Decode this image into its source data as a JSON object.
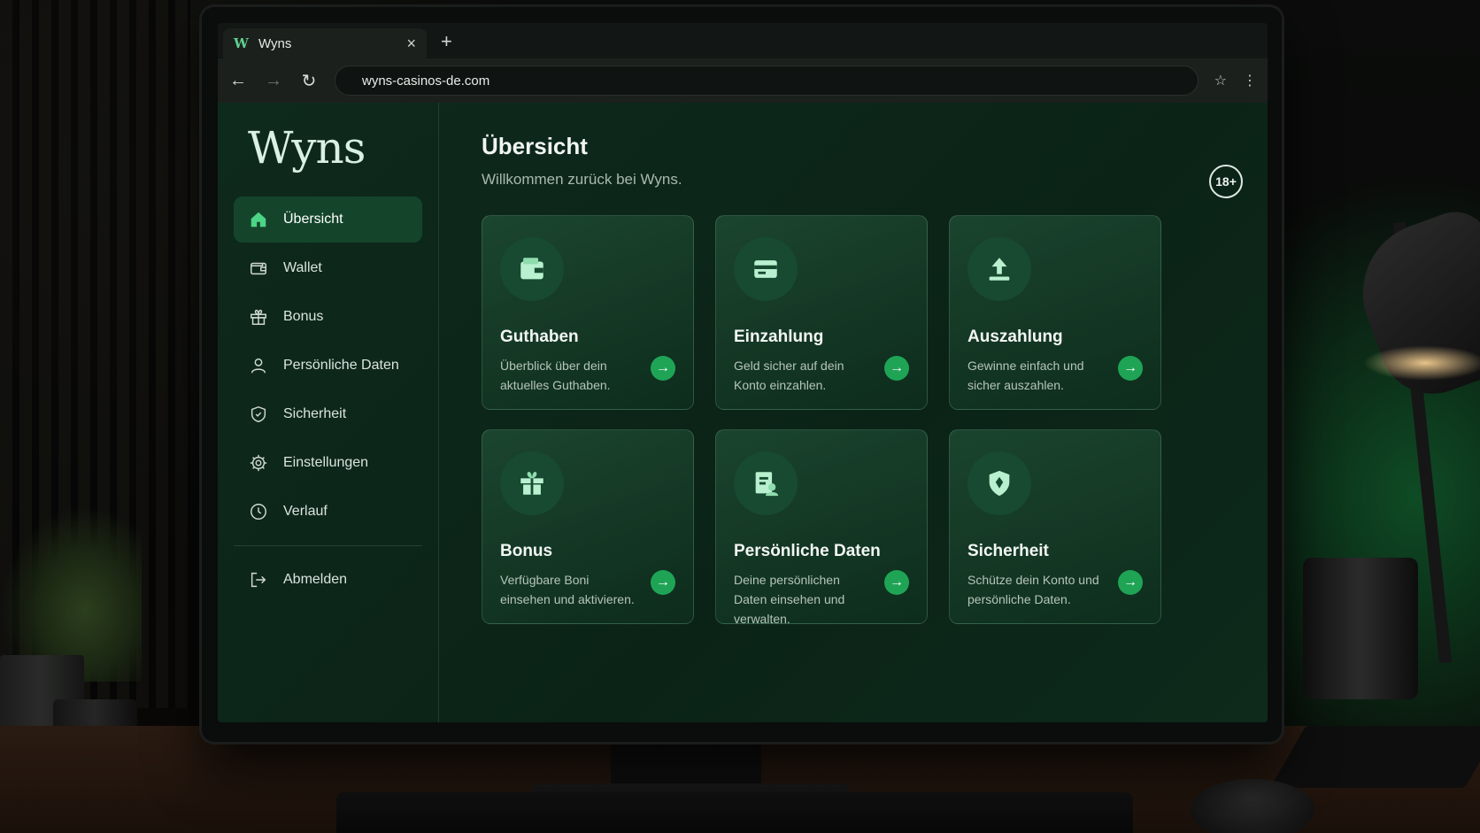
{
  "browser": {
    "tab_title": "Wyns",
    "tab_favicon": "W",
    "tab_close": "×",
    "new_tab": "+",
    "url": "wyns-casinos-de.com",
    "back": "←",
    "forward": "→",
    "reload": "↻",
    "bookmark": "☆",
    "menu": "⋮"
  },
  "sidebar": {
    "logo": "Wyns",
    "items": [
      {
        "label": "Übersicht",
        "icon": "home-icon",
        "active": true
      },
      {
        "label": "Wallet",
        "icon": "wallet-icon"
      },
      {
        "label": "Bonus",
        "icon": "gift-icon"
      },
      {
        "label": "Persönliche Daten",
        "icon": "user-icon"
      },
      {
        "label": "Sicherheit",
        "icon": "shield-icon"
      },
      {
        "label": "Einstellungen",
        "icon": "gear-icon"
      },
      {
        "label": "Verlauf",
        "icon": "clock-icon"
      }
    ],
    "logout": {
      "label": "Abmelden",
      "icon": "logout-icon"
    }
  },
  "main": {
    "title": "Übersicht",
    "subtitle": "Willkommen zurück bei Wyns.",
    "age_badge": "18+",
    "cards": [
      {
        "title": "Guthaben",
        "desc": "Überblick über dein aktuelles Guthaben.",
        "icon": "wallet-icon"
      },
      {
        "title": "Einzahlung",
        "desc": "Geld sicher auf dein Konto einzahlen.",
        "icon": "card-icon"
      },
      {
        "title": "Auszahlung",
        "desc": "Gewinne einfach und sicher auszahlen.",
        "icon": "upload-icon"
      },
      {
        "title": "Bonus",
        "desc": "Verfügbare Boni einsehen und aktivieren.",
        "icon": "gift-icon"
      },
      {
        "title": "Persönliche Daten",
        "desc": "Deine persönlichen Daten einsehen und verwalten.",
        "icon": "profile-doc-icon"
      },
      {
        "title": "Sicherheit",
        "desc": "Schütze dein Konto und persönliche Daten.",
        "icon": "shield-icon"
      }
    ],
    "arrow": "→"
  },
  "colors": {
    "accent": "#1fa456",
    "background": "#0c2318",
    "active_nav": "#14452b"
  }
}
